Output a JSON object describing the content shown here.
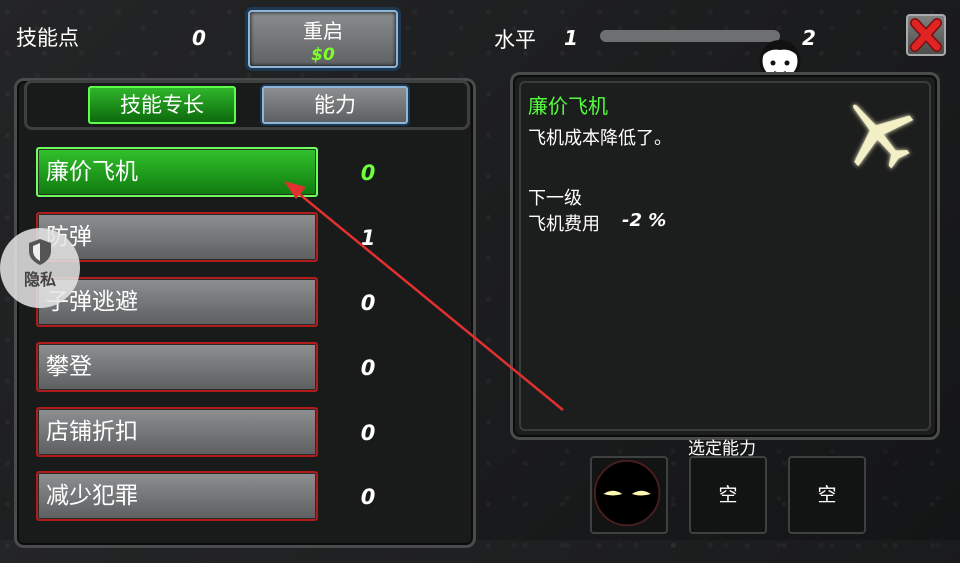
{
  "hud": {
    "skill_points_label": "技能点",
    "skill_points_value": "0",
    "restart_label": "重启",
    "restart_cost": "$0",
    "level_label": "水平",
    "level_current": "1",
    "level_next": "2",
    "level_progress": 0.0
  },
  "tabs": [
    {
      "label": "技能专长",
      "active": true
    },
    {
      "label": "能力",
      "active": false
    }
  ],
  "skills": [
    {
      "name": "廉价飞机",
      "level": "0",
      "selected": true
    },
    {
      "name": "防弹",
      "level": "1",
      "selected": false
    },
    {
      "name": "子弹逃避",
      "level": "0",
      "selected": false
    },
    {
      "name": "攀登",
      "level": "0",
      "selected": false
    },
    {
      "name": "店铺折扣",
      "level": "0",
      "selected": false
    },
    {
      "name": "减少犯罪",
      "level": "0",
      "selected": false
    }
  ],
  "detail": {
    "title": "廉价飞机",
    "description": "飞机成本降低了。",
    "next_level_label": "下一级",
    "stat_label": "飞机费用",
    "stat_value": "-2 %",
    "icon": "airplane-icon"
  },
  "abilities": {
    "label": "选定能力",
    "slots": [
      {
        "content": "",
        "icon": "glowing-eyes-icon"
      },
      {
        "content": "空"
      },
      {
        "content": "空"
      }
    ]
  },
  "privacy_badge": {
    "label": "隐私",
    "icon": "shield-icon"
  },
  "colors": {
    "accent_green": "#53ff3d",
    "selected_button": "#2fb52a",
    "button_border_red": "#b01c1c",
    "tab_border_blue": "#8fb6d8",
    "close_red": "#d82020"
  }
}
